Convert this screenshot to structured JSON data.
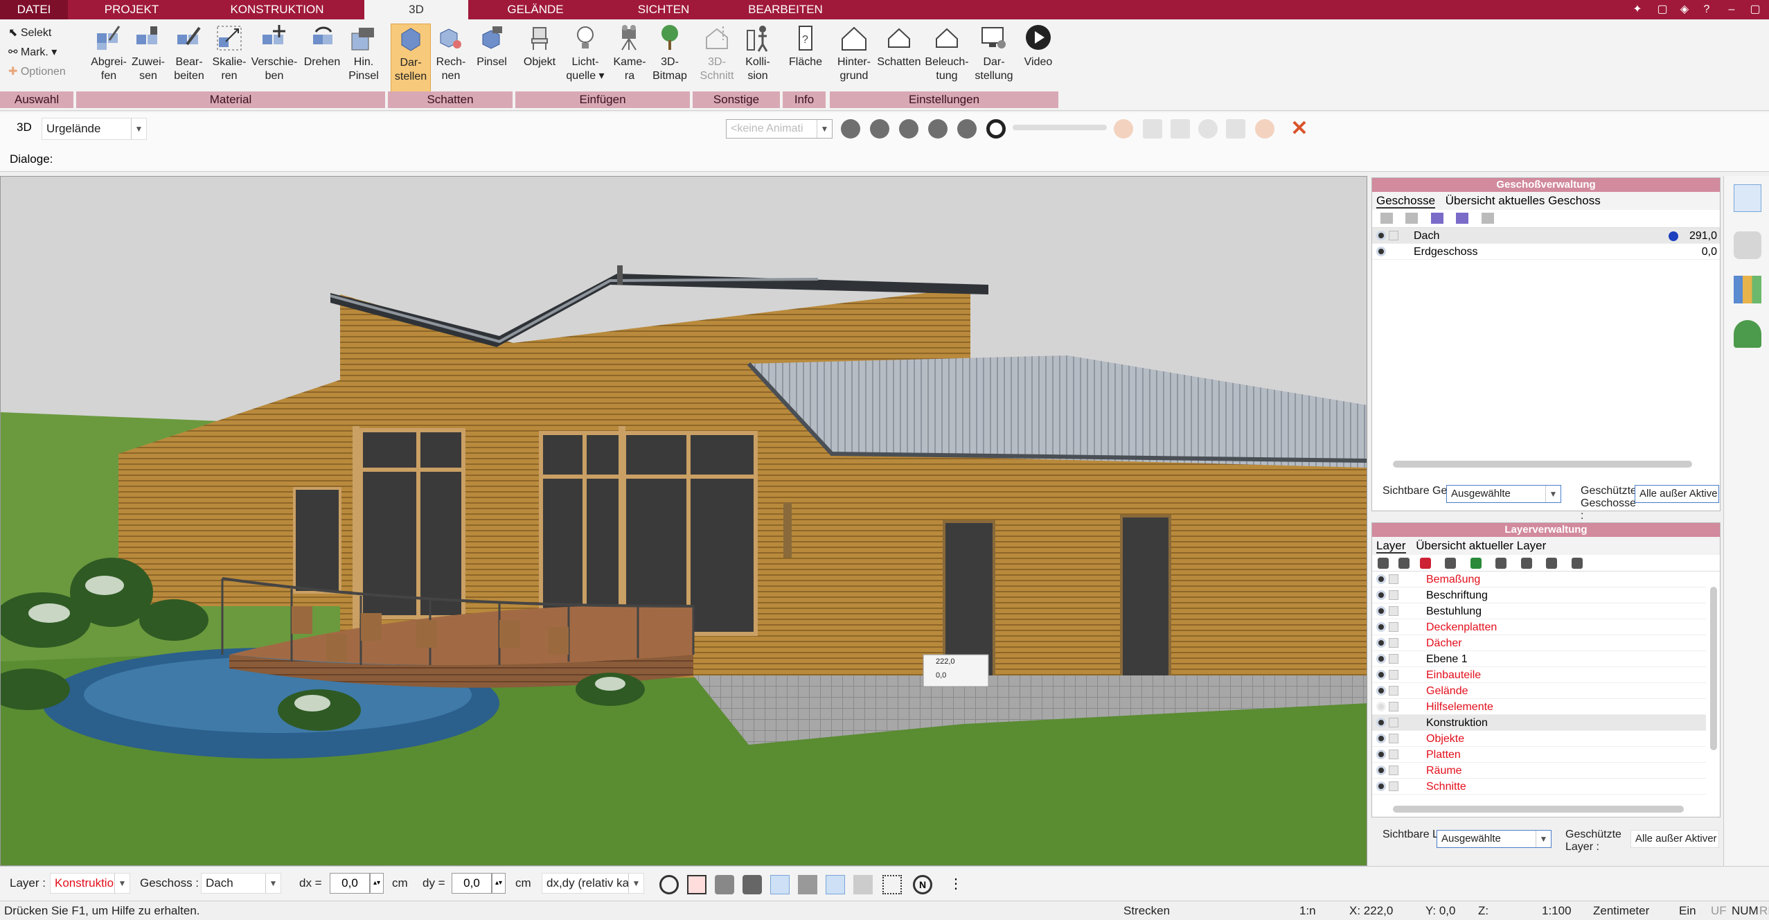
{
  "menu": {
    "tabs": [
      {
        "label": "DATEI"
      },
      {
        "label": "PROJEKT"
      },
      {
        "label": "KONSTRUKTION"
      },
      {
        "label": "3D"
      },
      {
        "label": "GELÄNDE"
      },
      {
        "label": "SICHTEN"
      },
      {
        "label": "BEARBEITEN"
      }
    ]
  },
  "ribbon": {
    "auswahl": {
      "selekt": "Selekt",
      "mark": "Mark. ▾",
      "optionen": "Optionen",
      "group": "Auswahl"
    },
    "material": {
      "group": "Material",
      "buttons": [
        {
          "l1": "Abgrei-",
          "l2": "fen"
        },
        {
          "l1": "Zuwei-",
          "l2": "sen"
        },
        {
          "l1": "Bear-",
          "l2": "beiten"
        },
        {
          "l1": "Skalie-",
          "l2": "ren"
        },
        {
          "l1": "Verschie-",
          "l2": "ben"
        },
        {
          "l1": "Drehen",
          "l2": ""
        },
        {
          "l1": "Hin.",
          "l2": "Pinsel"
        }
      ]
    },
    "schatten": {
      "group": "Schatten",
      "buttons": [
        {
          "l1": "Dar-",
          "l2": "stellen"
        },
        {
          "l1": "Rech-",
          "l2": "nen"
        },
        {
          "l1": "Pinsel",
          "l2": ""
        }
      ]
    },
    "einfuegen": {
      "group": "Einfügen",
      "buttons": [
        {
          "l1": "Objekt",
          "l2": ""
        },
        {
          "l1": "Licht-",
          "l2": "quelle ▾"
        },
        {
          "l1": "Kame-",
          "l2": "ra"
        },
        {
          "l1": "3D-",
          "l2": "Bitmap"
        }
      ]
    },
    "sonstige": {
      "group": "Sonstige",
      "buttons": [
        {
          "l1": "3D-",
          "l2": "Schnitt"
        },
        {
          "l1": "Kolli-",
          "l2": "sion"
        }
      ]
    },
    "info": {
      "group": "Info",
      "buttons": [
        {
          "l1": "Fläche",
          "l2": ""
        }
      ]
    },
    "einstellungen": {
      "group": "Einstellungen",
      "buttons": [
        {
          "l1": "Hinter-",
          "l2": "grund"
        },
        {
          "l1": "Schatten",
          "l2": ""
        },
        {
          "l1": "Beleuch-",
          "l2": "tung"
        },
        {
          "l1": "Dar-",
          "l2": "stellung"
        },
        {
          "l1": "Video",
          "l2": ""
        }
      ]
    }
  },
  "row3d": {
    "label": "3D",
    "terrain": "Urgelände",
    "animation": "<keine Animati"
  },
  "dialoge": {
    "label": "Dialoge:"
  },
  "viewport": {
    "tooltip": {
      "value1": "222,0",
      "value2": "0,0"
    }
  },
  "floor_panel": {
    "title": "Geschoßverwaltung",
    "tabs": [
      "Geschosse",
      "Übersicht aktuelles Geschoss"
    ],
    "rows": [
      {
        "name": "Dach",
        "height": "291,0"
      },
      {
        "name": "Erdgeschoss",
        "height": "0,0"
      }
    ],
    "visible_label": "Sichtbare Geschosse :",
    "visible_value": "Ausgewählte",
    "protected_label": "Geschützte Geschosse :",
    "protected_value": "Alle außer Aktive"
  },
  "layer_panel": {
    "title": "Layerverwaltung",
    "tabs": [
      "Layer",
      "Übersicht aktueller Layer"
    ],
    "rows": [
      {
        "name": "Bemaßung",
        "red": true
      },
      {
        "name": "Beschriftung",
        "red": false
      },
      {
        "name": "Bestuhlung",
        "red": false
      },
      {
        "name": "Deckenplatten",
        "red": true
      },
      {
        "name": "Dächer",
        "red": true
      },
      {
        "name": "Ebene 1",
        "red": false
      },
      {
        "name": "Einbauteile",
        "red": true
      },
      {
        "name": "Gelände",
        "red": true
      },
      {
        "name": "Hilfselemente",
        "red": true
      },
      {
        "name": "Konstruktion",
        "red": false
      },
      {
        "name": "Objekte",
        "red": true
      },
      {
        "name": "Platten",
        "red": true
      },
      {
        "name": "Räume",
        "red": true
      },
      {
        "name": "Schnitte",
        "red": true
      }
    ],
    "visible_label": "Sichtbare Layer :",
    "visible_value": "Ausgewählte",
    "protected_label": "Geschützte Layer :",
    "protected_value": "Alle außer Aktiver"
  },
  "bottom": {
    "layer_label": "Layer :",
    "layer_value": "Konstruktio",
    "geschoss_label": "Geschoss :",
    "geschoss_value": "Dach",
    "dx_label": "dx =",
    "dx_value": "0,0",
    "dx_unit": "cm",
    "dy_label": "dy =",
    "dy_value": "0,0",
    "dy_unit": "cm",
    "mode_value": "dx,dy (relativ ka"
  },
  "status": {
    "help": "Drücken Sie F1, um Hilfe zu erhalten.",
    "mode": "Strecken",
    "ratio": "1:n",
    "x": "X: 222,0",
    "y": "Y: 0,0",
    "z": "Z:",
    "scale": "1:100",
    "unit": "Zentimeter",
    "ein": "Ein",
    "uf": "UF",
    "num": "NUM",
    "ri": "RI"
  },
  "colors": {
    "accent": "#a0193a",
    "group_band": "#d8a9b4",
    "panel_title": "#d28a9d",
    "active_button": "#f7c97a",
    "red_layer": "#e30e1b"
  }
}
